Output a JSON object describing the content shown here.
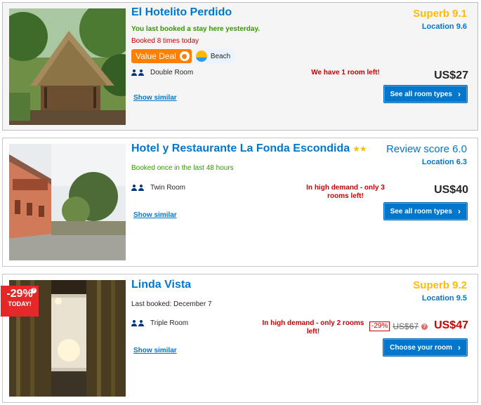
{
  "listings": [
    {
      "name": "El Hotelito Perdido",
      "score_text": "Superb 9.1",
      "location_text": "Location 9.6",
      "last_booked": "You last booked a stay here yesterday.",
      "booked_count": "Booked 8 times today",
      "value_deal_label": "Value Deal",
      "beach_label": "Beach",
      "room_type": "Double Room",
      "urgency": "We have 1 room left!",
      "price": "US$27",
      "show_similar": "Show similar",
      "button_label": "See all room types",
      "button_icon": "chevron-right-icon"
    },
    {
      "name": "Hotel y Restaurante La Fonda Escondida",
      "stars": "★★",
      "score_text": "Review score 6.0",
      "location_text": "Location 6.3",
      "booked_text": "Booked once in the last 48 hours",
      "room_type": "Twin Room",
      "urgency": "In high demand - only 3 rooms left!",
      "price": "US$40",
      "show_similar": "Show similar",
      "button_label": "See all room types",
      "button_icon": "chevron-right-icon"
    },
    {
      "name": "Linda Vista",
      "discount_badge": "-29%",
      "discount_today": "TODAY!",
      "score_text": "Superb 9.2",
      "location_text": "Location 9.5",
      "last_booked": "Last booked: December 7",
      "room_type": "Triple Room",
      "urgency": "In high demand - only 2 rooms left!",
      "discount_pct": "-29%",
      "old_price": "US$67",
      "price": "US$47",
      "show_similar": "Show similar",
      "button_label": "Choose your room",
      "button_icon": "chevron-right-icon"
    }
  ],
  "colors": {
    "link_blue": "#0077cc",
    "score_gold": "#febb02",
    "urgent_red": "#cc0000",
    "value_deal_orange": "#ff8000",
    "badge_red": "#e42727"
  }
}
